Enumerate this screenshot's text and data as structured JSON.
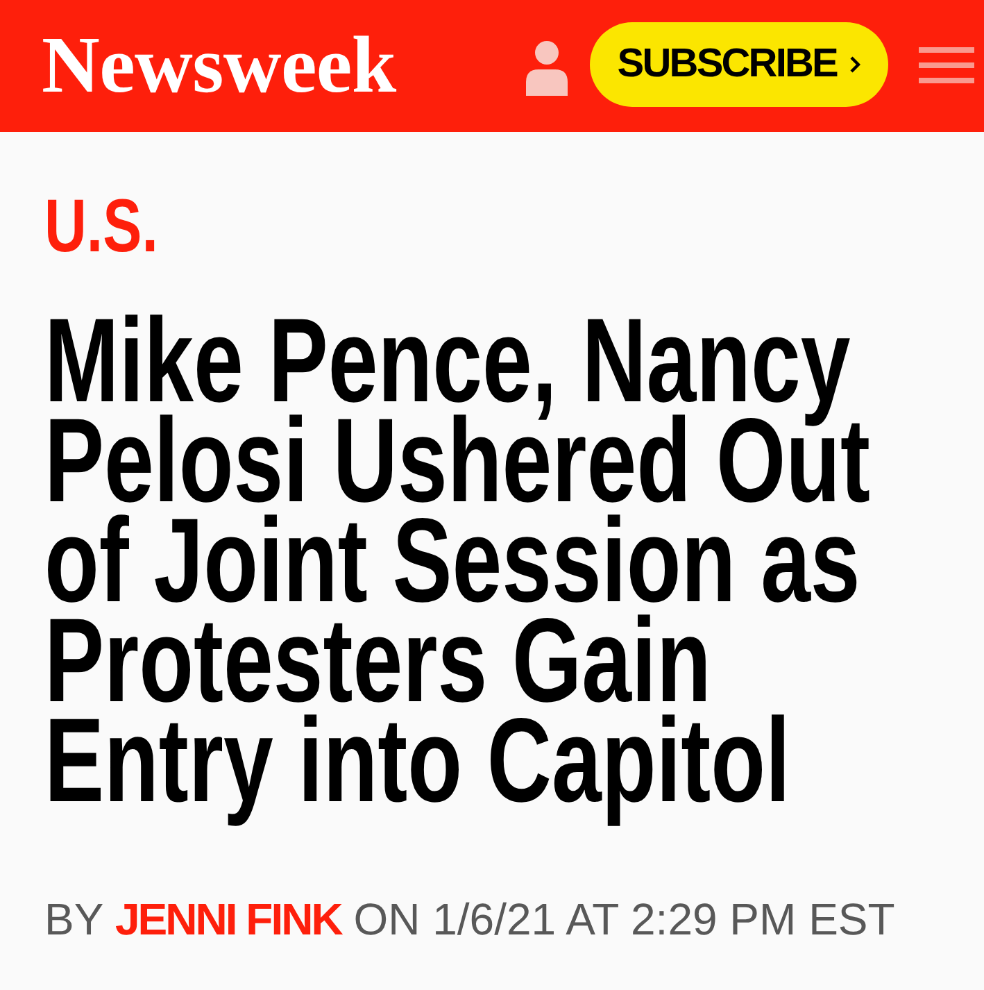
{
  "header": {
    "logo": "Newsweek",
    "subscribe_button": {
      "label": "SUBSCRIBE"
    }
  },
  "article": {
    "section": "U.S.",
    "headline": "Mike Pence, Nancy Pelosi Ushered Out of Joint Session as Protesters Gain Entry into Capitol",
    "byline": {
      "prefix": "BY",
      "author": "JENNI FINK",
      "timestamp": "ON 1/6/21 AT 2:29 PM EST"
    }
  }
}
